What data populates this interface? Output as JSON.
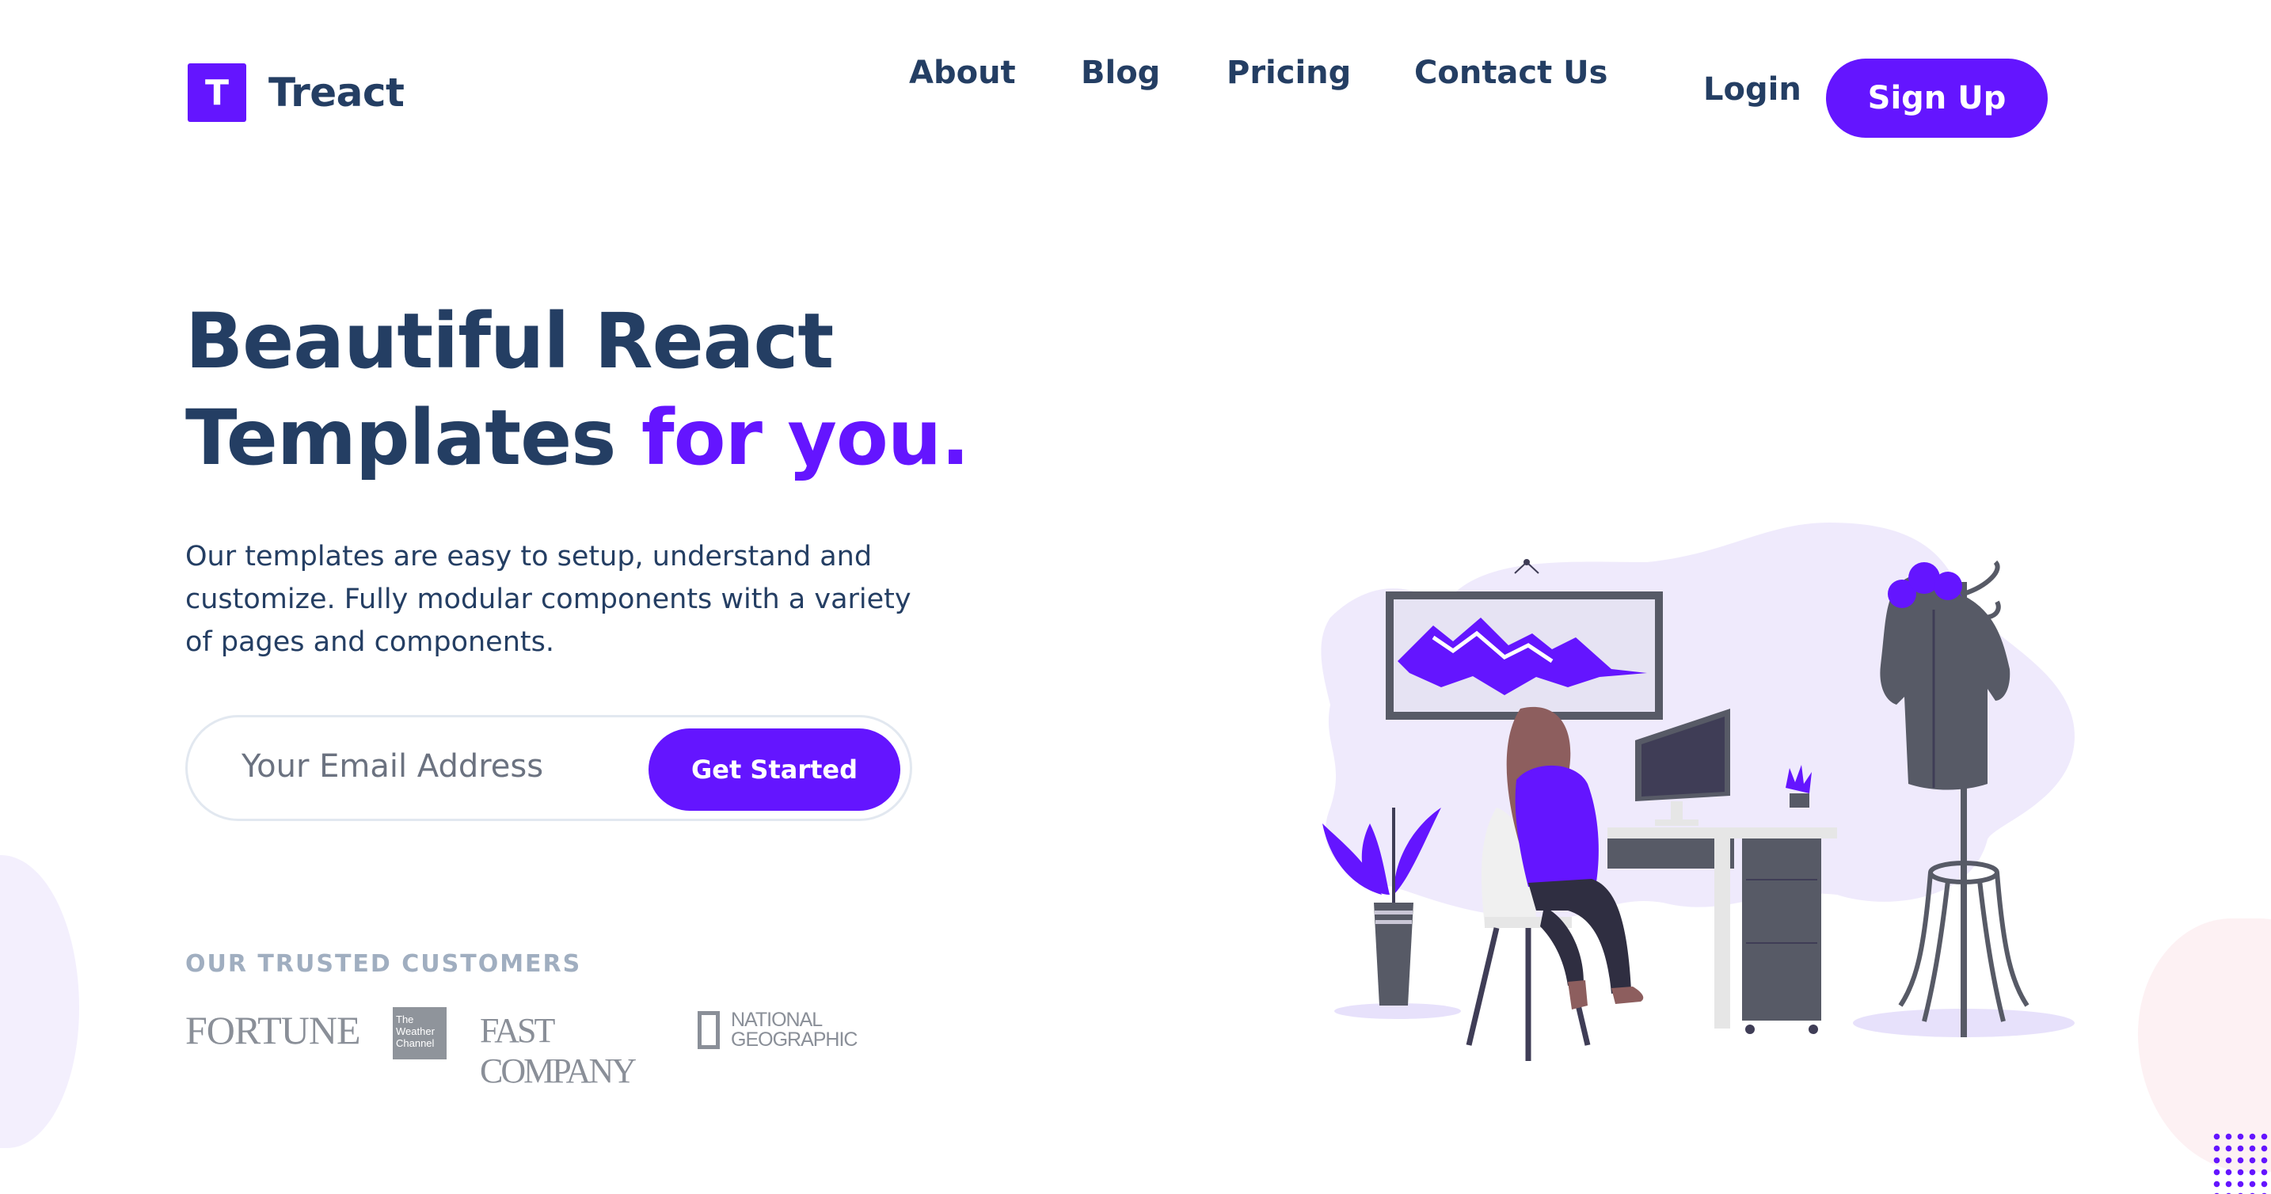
{
  "brand": {
    "logo_letter": "T",
    "name": "Treact"
  },
  "nav": {
    "links": [
      "About",
      "Blog",
      "Pricing",
      "Contact Us"
    ],
    "login": "Login",
    "signup": "Sign Up"
  },
  "hero": {
    "title_line1": "Beautiful React",
    "title_line2_plain": "Templates ",
    "title_line2_accent": "for you.",
    "description": "Our templates are easy to setup, understand and customize. Fully modular components with a variety of pages and components."
  },
  "signup_form": {
    "email_placeholder": "Your Email Address",
    "button": "Get Started"
  },
  "trusted": {
    "label": "OUR TRUSTED CUSTOMERS",
    "logos": {
      "fortune": "FORTUNE",
      "weather_line1": "The",
      "weather_line2": "Weather",
      "weather_line3": "Channel",
      "fastcompany": "FAST COMPANY",
      "natgeo_line1": "NATIONAL",
      "natgeo_line2": "GEOGRAPHIC"
    }
  },
  "colors": {
    "primary": "#6415ff",
    "text": "#243e63",
    "muted": "#a0aec0"
  }
}
